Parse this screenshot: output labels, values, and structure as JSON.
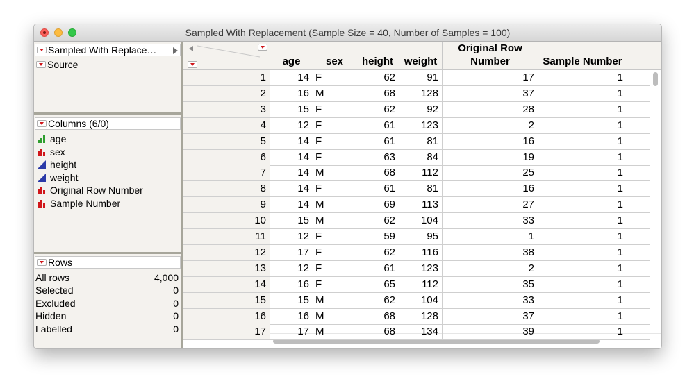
{
  "window": {
    "title": "Sampled With Replacement (Sample Size = 40, Number of Samples = 100)"
  },
  "panel": {
    "table_name": "Sampled With Replace…",
    "source_label": "Source",
    "columns_header": "Columns (6/0)",
    "columns": [
      {
        "name": "age",
        "icon": "ordinal-icon"
      },
      {
        "name": "sex",
        "icon": "nominal-icon"
      },
      {
        "name": "height",
        "icon": "continuous-icon"
      },
      {
        "name": "weight",
        "icon": "continuous-icon"
      },
      {
        "name": "Original Row Number",
        "icon": "nominal-icon"
      },
      {
        "name": "Sample Number",
        "icon": "nominal-icon"
      }
    ],
    "rows_header": "Rows",
    "row_stats": [
      {
        "label": "All rows",
        "value": "4,000"
      },
      {
        "label": "Selected",
        "value": "0"
      },
      {
        "label": "Excluded",
        "value": "0"
      },
      {
        "label": "Hidden",
        "value": "0"
      },
      {
        "label": "Labelled",
        "value": "0"
      }
    ]
  },
  "colors": {
    "modeling_green": "#2f9e2f",
    "nominal_red": "#d0161a",
    "continuous_blue": "#2b3aa8",
    "menu_red": "#d0161a"
  },
  "table": {
    "headers": [
      "age",
      "sex",
      "height",
      "weight",
      "Original Row Number",
      "Sample Number"
    ],
    "rows": [
      [
        "1",
        "14",
        "F",
        "62",
        "91",
        "17",
        "1"
      ],
      [
        "2",
        "16",
        "M",
        "68",
        "128",
        "37",
        "1"
      ],
      [
        "3",
        "15",
        "F",
        "62",
        "92",
        "28",
        "1"
      ],
      [
        "4",
        "12",
        "F",
        "61",
        "123",
        "2",
        "1"
      ],
      [
        "5",
        "14",
        "F",
        "61",
        "81",
        "16",
        "1"
      ],
      [
        "6",
        "14",
        "F",
        "63",
        "84",
        "19",
        "1"
      ],
      [
        "7",
        "14",
        "M",
        "68",
        "112",
        "25",
        "1"
      ],
      [
        "8",
        "14",
        "F",
        "61",
        "81",
        "16",
        "1"
      ],
      [
        "9",
        "14",
        "M",
        "69",
        "113",
        "27",
        "1"
      ],
      [
        "10",
        "15",
        "M",
        "62",
        "104",
        "33",
        "1"
      ],
      [
        "11",
        "12",
        "F",
        "59",
        "95",
        "1",
        "1"
      ],
      [
        "12",
        "17",
        "F",
        "62",
        "116",
        "38",
        "1"
      ],
      [
        "13",
        "12",
        "F",
        "61",
        "123",
        "2",
        "1"
      ],
      [
        "14",
        "16",
        "F",
        "65",
        "112",
        "35",
        "1"
      ],
      [
        "15",
        "15",
        "M",
        "62",
        "104",
        "33",
        "1"
      ],
      [
        "16",
        "16",
        "M",
        "68",
        "128",
        "37",
        "1"
      ],
      [
        "17",
        "17",
        "M",
        "68",
        "134",
        "39",
        "1"
      ]
    ]
  }
}
